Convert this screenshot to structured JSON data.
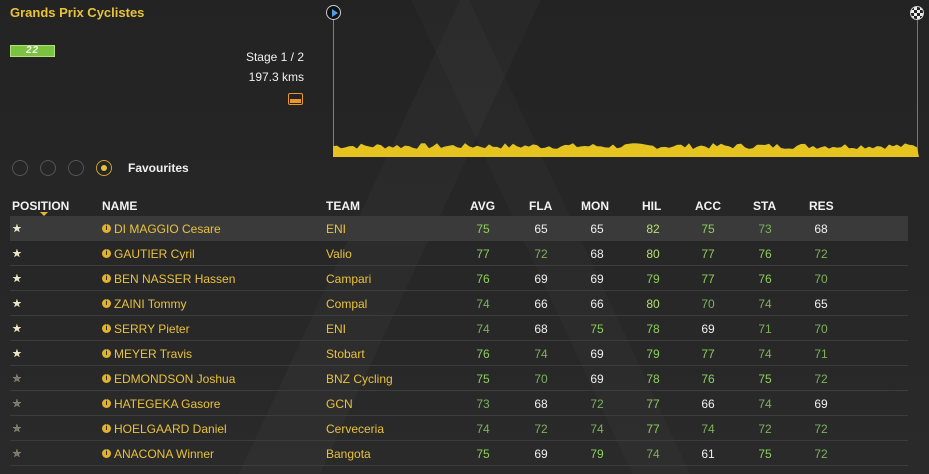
{
  "race": {
    "title": "Grands Prix Cyclistes",
    "badge": "22",
    "stage_label": "Stage 1 / 2",
    "distance": "197.3 kms",
    "stage_type_icon": "flat-stage-icon"
  },
  "profile": {
    "start_icon": "play-icon",
    "finish_icon": "checkered-flag-icon",
    "fill_color": "#e6c420"
  },
  "filter": {
    "options_count": 4,
    "selected_index": 3,
    "selected_label": "Favourites"
  },
  "columns": [
    "POSITION",
    "NAME",
    "TEAM",
    "AVG",
    "FLA",
    "MON",
    "HIL",
    "ACC",
    "STA",
    "RES"
  ],
  "colors": {
    "accent": "#e9c23b",
    "stat_high": "#b6e06c",
    "stat_good": "#8ccf5a",
    "stat_mid": "#7cb25c",
    "stat_low": "#f0f0f0",
    "highlight_row": "#3a3a3a"
  },
  "riders": [
    {
      "stars": 3,
      "name": "DI MAGGIO Cesare",
      "team": "ENI",
      "stats": [
        75,
        65,
        65,
        82,
        75,
        73,
        68
      ],
      "highlight": true
    },
    {
      "stars": 3,
      "name": "GAUTIER Cyril",
      "team": "Valio",
      "stats": [
        77,
        72,
        68,
        80,
        77,
        76,
        72
      ],
      "highlight": false
    },
    {
      "stars": 3,
      "name": "BEN NASSER Hassen",
      "team": "Campari",
      "stats": [
        76,
        69,
        69,
        79,
        77,
        76,
        70
      ],
      "highlight": false
    },
    {
      "stars": 2.5,
      "name": "ZAINI Tommy",
      "team": "Compal",
      "stats": [
        74,
        66,
        66,
        80,
        70,
        74,
        65
      ],
      "highlight": false
    },
    {
      "stars": 2.5,
      "name": "SERRY Pieter",
      "team": "ENI",
      "stats": [
        74,
        68,
        75,
        78,
        69,
        71,
        70
      ],
      "highlight": false
    },
    {
      "stars": 2.5,
      "name": "MEYER Travis",
      "team": "Stobart",
      "stats": [
        76,
        74,
        69,
        79,
        77,
        74,
        71
      ],
      "highlight": false
    },
    {
      "stars": 1.5,
      "name": "EDMONDSON Joshua",
      "team": "BNZ Cycling",
      "stats": [
        75,
        70,
        69,
        78,
        76,
        75,
        72
      ],
      "highlight": false
    },
    {
      "stars": 1.5,
      "name": "HATEGEKA Gasore",
      "team": "GCN",
      "stats": [
        73,
        68,
        72,
        77,
        66,
        74,
        69
      ],
      "highlight": false
    },
    {
      "stars": 1.5,
      "name": "HOELGAARD Daniel",
      "team": "Cerveceria",
      "stats": [
        74,
        72,
        74,
        77,
        74,
        72,
        72
      ],
      "highlight": false
    },
    {
      "stars": 1.5,
      "name": "ANACONA Winner",
      "team": "Bangota",
      "stats": [
        75,
        69,
        79,
        74,
        61,
        75,
        72
      ],
      "highlight": false
    }
  ]
}
